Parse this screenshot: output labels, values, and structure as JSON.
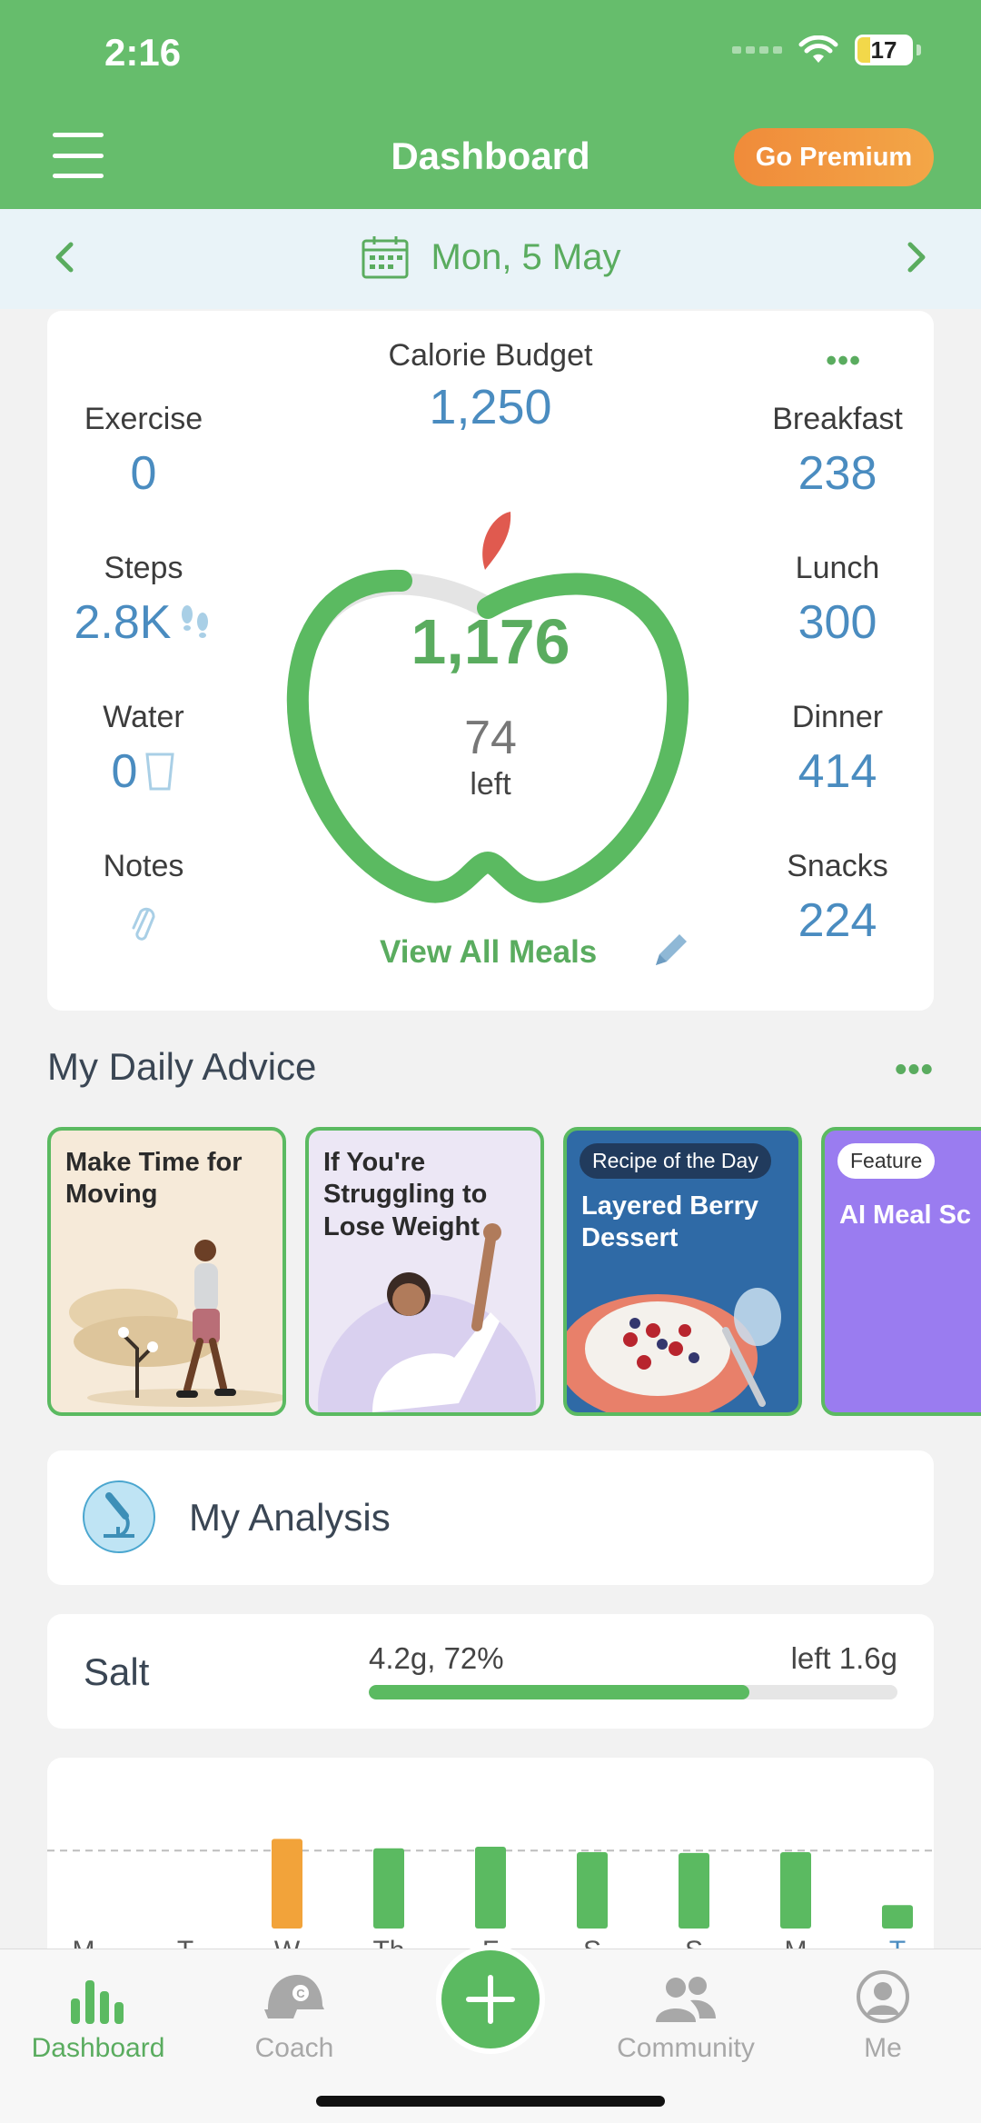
{
  "status_bar": {
    "time": "2:16",
    "battery": "17"
  },
  "header": {
    "title": "Dashboard",
    "premium_label": "Go Premium"
  },
  "date_bar": {
    "date": "Mon, 5 May"
  },
  "calorie_card": {
    "budget_label": "Calorie Budget",
    "budget_value": "1,250",
    "consumed": "1,176",
    "left_value": "74",
    "left_label": "left",
    "left_progress_fraction": 0.94,
    "view_all_label": "View All Meals",
    "left_column": [
      {
        "label": "Exercise",
        "value": "0"
      },
      {
        "label": "Steps",
        "value": "2.8K"
      },
      {
        "label": "Water",
        "value": "0"
      },
      {
        "label": "Notes",
        "value": ""
      }
    ],
    "right_column": [
      {
        "label": "Breakfast",
        "value": "238"
      },
      {
        "label": "Lunch",
        "value": "300"
      },
      {
        "label": "Dinner",
        "value": "414"
      },
      {
        "label": "Snacks",
        "value": "224"
      }
    ]
  },
  "advice": {
    "title": "My Daily Advice",
    "cards": [
      {
        "title": "Make Time for Moving",
        "tag": ""
      },
      {
        "title": "If You're Struggling to Lose Weight",
        "tag": ""
      },
      {
        "title": "Layered Berry Dessert",
        "tag": "Recipe of the Day"
      },
      {
        "title": "AI Meal Sc",
        "tag": "Feature"
      }
    ]
  },
  "analysis": {
    "title": "My Analysis"
  },
  "salt": {
    "label": "Salt",
    "amount": "4.2g, 72%",
    "left": "left 1.6g",
    "progress_fraction": 0.72
  },
  "colors": {
    "green": "#5bba61",
    "blue_value": "#4a8cc0",
    "orange": "#f2a33a"
  },
  "chart_data": {
    "type": "bar",
    "categories": [
      "M",
      "T",
      "W",
      "Th",
      "F",
      "S",
      "S",
      "M",
      "T"
    ],
    "values": [
      0,
      0,
      1.15,
      1.03,
      1.05,
      0.98,
      0.97,
      0.98,
      0.3
    ],
    "highlight_index": 2,
    "reference_line": 1.0,
    "ylim": [
      0,
      1.4
    ]
  },
  "bottom_nav": {
    "items": [
      {
        "label": "Dashboard",
        "icon": "bar-chart-icon"
      },
      {
        "label": "Coach",
        "icon": "coach-cap-icon"
      },
      {
        "label": "Community",
        "icon": "community-people-icon"
      },
      {
        "label": "Me",
        "icon": "user-profile-icon"
      }
    ]
  }
}
